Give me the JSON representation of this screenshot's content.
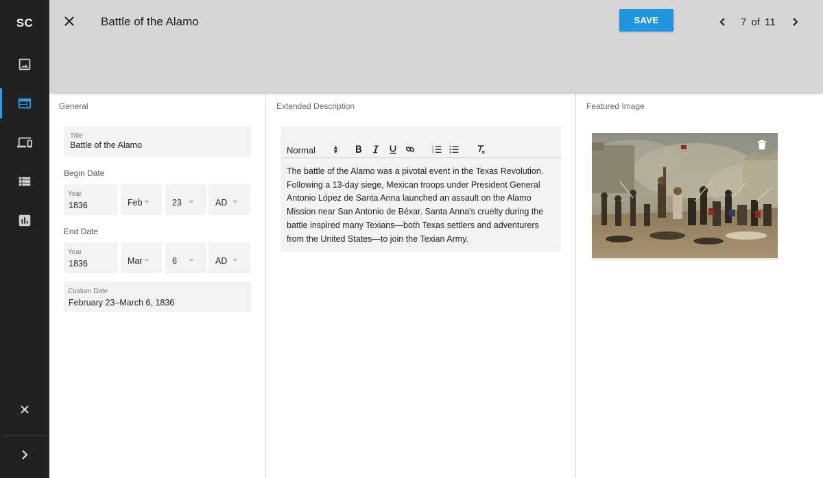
{
  "sidebar": {
    "logo": "SC",
    "items": [
      {
        "name": "image-icon",
        "active": false
      },
      {
        "name": "web-icon",
        "active": true
      },
      {
        "name": "devices-icon",
        "active": false
      },
      {
        "name": "list-icon",
        "active": false
      },
      {
        "name": "chart-icon",
        "active": false
      }
    ]
  },
  "header": {
    "title": "Battle of the Alamo",
    "save_label": "SAVE",
    "pager_text": "7 of 11"
  },
  "general": {
    "section_label": "General",
    "title_label": "Title",
    "title_value": "Battle of the Alamo",
    "begin_date_label": "Begin Date",
    "begin": {
      "year_label": "Year",
      "year": "1836",
      "month": "Feb",
      "day": "23",
      "era": "AD"
    },
    "end_date_label": "End Date",
    "end": {
      "year_label": "Year",
      "year": "1836",
      "month": "Mar",
      "day": "6",
      "era": "AD"
    },
    "custom_date_label": "Custom Date",
    "custom_date_value": "February 23–March 6, 1836"
  },
  "description": {
    "section_label": "Extended Description",
    "format_label": "Normal",
    "text": "The battle of the Alamo was a pivotal event in the Texas Revolution. Following a 13-day siege, Mexican troops under President General Antonio López de Santa Anna launched an assault on the Alamo Mission near San Antonio de Béxar. Santa Anna's cruelty during the battle inspired many Texians—both Texas settlers and adventurers from the United States—to join the Texian Army."
  },
  "featured": {
    "section_label": "Featured Image"
  },
  "colors": {
    "accent": "#2196e0",
    "sidebar_bg": "#212121",
    "header_bg": "#d6d6d6",
    "field_bg": "#f3f3f3"
  }
}
